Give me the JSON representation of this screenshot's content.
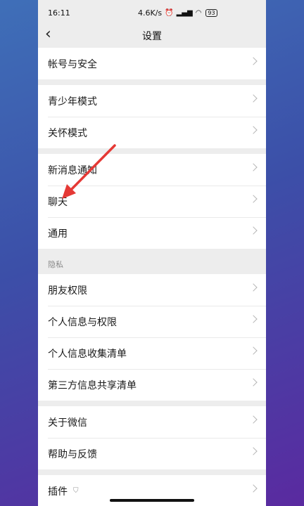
{
  "status": {
    "time": "16:11",
    "speed": "4.6K/s",
    "battery": "93"
  },
  "nav": {
    "title": "设置"
  },
  "groups": {
    "account": [
      "帐号与安全"
    ],
    "modes": [
      "青少年模式",
      "关怀模式"
    ],
    "notify": [
      "新消息通知",
      "聊天",
      "通用"
    ],
    "privacy_label": "隐私",
    "privacy": [
      "朋友权限",
      "个人信息与权限",
      "个人信息收集清单",
      "第三方信息共享清单"
    ],
    "about": [
      "关于微信",
      "帮助与反馈"
    ],
    "plugins": [
      "插件"
    ]
  },
  "colors": {
    "accent_arrow": "#e53935"
  }
}
